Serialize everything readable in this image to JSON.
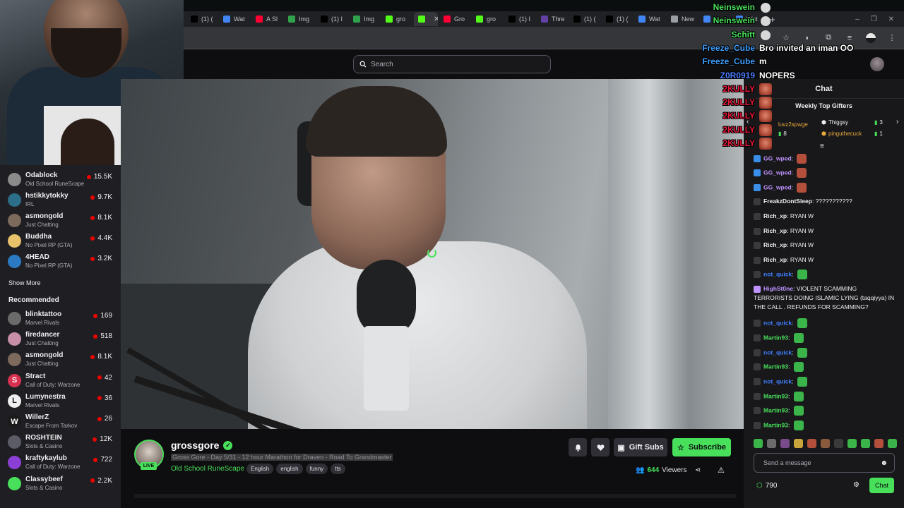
{
  "browser": {
    "tabs": [
      {
        "label": "(1) (",
        "icon": "x-logo",
        "color": "#000000"
      },
      {
        "label": "Wat",
        "icon": "globe-icon",
        "color": "#4285f4"
      },
      {
        "label": "A Sl",
        "icon": "youtube-icon",
        "color": "#ff0033"
      },
      {
        "label": "Img",
        "icon": "image-icon",
        "color": "#31a24c"
      },
      {
        "label": "(1) I",
        "icon": "x-logo",
        "color": "#000000"
      },
      {
        "label": "Img",
        "icon": "image-icon",
        "color": "#31a24c"
      },
      {
        "label": "gro",
        "icon": "kick-icon",
        "color": "#53fc18"
      },
      {
        "label": "",
        "icon": "kick-icon",
        "color": "#53fc18",
        "active": true
      },
      {
        "label": "Gro",
        "icon": "youtube-icon",
        "color": "#ff0033"
      },
      {
        "label": "gro",
        "icon": "kick-icon",
        "color": "#53fc18"
      },
      {
        "label": "(1) I",
        "icon": "x-logo",
        "color": "#000000"
      },
      {
        "label": "Thre",
        "icon": "threads-icon",
        "color": "#6441a5"
      },
      {
        "label": "(1) (",
        "icon": "x-logo",
        "color": "#000000"
      },
      {
        "label": "(1) (",
        "icon": "x-logo",
        "color": "#000000"
      },
      {
        "label": "Wat",
        "icon": "globe-icon",
        "color": "#4285f4"
      },
      {
        "label": "New",
        "icon": "chrome-icon",
        "color": "#9aa0a6"
      },
      {
        "label": "",
        "icon": "globe-icon",
        "color": "#4285f4"
      },
      {
        "label": "Wat",
        "icon": "globe-icon",
        "color": "#4285f4"
      }
    ],
    "newtab": "+",
    "window_controls": [
      "–",
      "❐",
      "✕"
    ]
  },
  "topnav": {
    "search_placeholder": "Search"
  },
  "sidebar": {
    "following": [
      {
        "name": "Odablock",
        "game": "Old School RuneScape",
        "viewers": "15.5K",
        "avatar": "#8a8a8a",
        "initial": ""
      },
      {
        "name": "hstikkytokky",
        "game": "IRL",
        "viewers": "9.7K",
        "avatar": "#2d6e8a",
        "initial": ""
      },
      {
        "name": "asmongold",
        "game": "Just Chatting",
        "viewers": "8.1K",
        "avatar": "#7d6a5c",
        "initial": ""
      },
      {
        "name": "Buddha",
        "game": "No Pixel RP (GTA)",
        "viewers": "4.4K",
        "avatar": "#e8c26a",
        "initial": ""
      },
      {
        "name": "4HEAD",
        "game": "No Pixel RP (GTA)",
        "viewers": "3.2K",
        "avatar": "#2a7bc4",
        "initial": ""
      }
    ],
    "show_more": "Show More",
    "recommended_title": "Recommended",
    "recommended": [
      {
        "name": "blinktattoo",
        "game": "Marvel Rivals",
        "viewers": "169",
        "avatar": "#6b6b6b",
        "initial": ""
      },
      {
        "name": "firedancer",
        "game": "Just Chatting",
        "viewers": "518",
        "avatar": "#c78fa8",
        "initial": ""
      },
      {
        "name": "asmongold",
        "game": "Just Chatting",
        "viewers": "8.1K",
        "avatar": "#7d6a5c",
        "initial": ""
      },
      {
        "name": "Stract",
        "game": "Call of Duty: Warzone",
        "viewers": "42",
        "avatar": "#d8314f",
        "initial": "S"
      },
      {
        "name": "Lumynestra",
        "game": "Marvel Rivals",
        "viewers": "36",
        "avatar": "#efeff1",
        "initial": "L"
      },
      {
        "name": "WillerZ",
        "game": "Escape From Tarkov",
        "viewers": "26",
        "avatar": "#1a1a1a",
        "initial": "W"
      },
      {
        "name": "ROSHTEIN",
        "game": "Slots & Casino",
        "viewers": "12K",
        "avatar": "#5c5c66",
        "initial": ""
      },
      {
        "name": "kraftykaylub",
        "game": "Call of Duty: Warzone",
        "viewers": "722",
        "avatar": "#8c3fd6",
        "initial": ""
      },
      {
        "name": "Classybeef",
        "game": "Slots & Casino",
        "viewers": "2.2K",
        "avatar": "#48e05a",
        "initial": ""
      }
    ]
  },
  "stream": {
    "streamer": "grossgore",
    "live_label": "LIVE",
    "title": "Gross Gore - Day 5/31 - 12 hour Marathon for Draven - Road To Grandmaster",
    "category": "Old School RuneScape",
    "tags": [
      "English",
      "english",
      "funny",
      "tts"
    ],
    "gift_label": "Gift Subs",
    "subscribe_label": "Subscribe",
    "viewer_count": "644",
    "viewers_label": "Viewers"
  },
  "chat": {
    "header": "Chat",
    "gifters_title": "Weekly Top Gifters",
    "gifters": [
      {
        "name": "luvz2spwge",
        "count": "8",
        "color": "#e8a93a"
      },
      {
        "name": "Thiggsy",
        "count": "3",
        "color": "#efeff1"
      },
      {
        "name": "pinguthecuck",
        "count": "1",
        "color": "#e8a93a"
      }
    ],
    "messages": [
      {
        "user": "GG_wped",
        "text": "",
        "color": "#bf94ff",
        "emote": "#b44f3c",
        "badge": "#3b8ee8"
      },
      {
        "user": "GG_wped",
        "text": "",
        "color": "#bf94ff",
        "emote": "#b44f3c",
        "badge": "#3b8ee8"
      },
      {
        "user": "GG_wped",
        "text": "",
        "color": "#bf94ff",
        "emote": "#b44f3c",
        "badge": "#3b8ee8"
      },
      {
        "user": "FreakzDontSleep",
        "text": "???????????",
        "color": "#efeff1",
        "emote": "",
        "badge": ""
      },
      {
        "user": "Rich_xp",
        "text": "RYAN W",
        "color": "#efeff1",
        "emote": "",
        "badge": ""
      },
      {
        "user": "Rich_xp",
        "text": "RYAN W",
        "color": "#efeff1",
        "emote": "",
        "badge": ""
      },
      {
        "user": "Rich_xp",
        "text": "RYAN W",
        "color": "#efeff1",
        "emote": "",
        "badge": ""
      },
      {
        "user": "Rich_xp",
        "text": "RYAN W",
        "color": "#efeff1",
        "emote": "",
        "badge": ""
      },
      {
        "user": "not_quick",
        "text": "",
        "color": "#3f7fff",
        "emote": "#3bb54a",
        "badge": ""
      },
      {
        "user": "HighSt0ne",
        "text": "VIOLENT SCAMMING TERRORISTS DOING ISLAMIC LYING (taqqiyya) IN THE CALL . REFUNDS FOR SCAMMING?",
        "color": "#bf94ff",
        "emote": "",
        "badge": "#bf94ff"
      },
      {
        "user": "not_quick",
        "text": "",
        "color": "#3f7fff",
        "emote": "#3bb54a",
        "badge": ""
      },
      {
        "user": "Martin93",
        "text": "",
        "color": "#48e05a",
        "emote": "#3bb54a",
        "badge": ""
      },
      {
        "user": "not_quick",
        "text": "",
        "color": "#3f7fff",
        "emote": "#3bb54a",
        "badge": ""
      },
      {
        "user": "Martin93",
        "text": "",
        "color": "#48e05a",
        "emote": "#3bb54a",
        "badge": ""
      },
      {
        "user": "not_quick",
        "text": "",
        "color": "#3f7fff",
        "emote": "#3bb54a",
        "badge": ""
      },
      {
        "user": "Martin93",
        "text": "",
        "color": "#48e05a",
        "emote": "#3bb54a",
        "badge": ""
      },
      {
        "user": "Martin93",
        "text": "",
        "color": "#48e05a",
        "emote": "#3bb54a",
        "badge": ""
      },
      {
        "user": "Martin93",
        "text": "",
        "color": "#48e05a",
        "emote": "#3bb54a",
        "badge": ""
      }
    ],
    "emote_bar": [
      "#3bb54a",
      "#6b6b6b",
      "#7a4b8c",
      "#c8a43a",
      "#b44f3c",
      "#8a5a3c",
      "#3a3a3a",
      "#3bb54a",
      "#3bb54a",
      "#b44f3c",
      "#3bb54a"
    ],
    "input_placeholder": "Send a message",
    "points": "790",
    "chat_button": "Chat"
  },
  "overlay_chat": [
    {
      "user": "Neinswein",
      "text": "",
      "color": "#48e05a",
      "emote": "skull"
    },
    {
      "user": "Neinswein",
      "text": "",
      "color": "#48e05a",
      "emote": "skull"
    },
    {
      "user": "Schitt",
      "text": "",
      "color": "#48e05a",
      "emote": "skull"
    },
    {
      "user": "Freeze_Cube",
      "text": "Bro invited an iman OO",
      "color": "#3f9fff",
      "emote": ""
    },
    {
      "user": "Freeze_Cube",
      "text": "m",
      "color": "#3f9fff",
      "emote": ""
    },
    {
      "user": "Z0R0919",
      "text": "NOPERS",
      "color": "#4b7bff",
      "emote": ""
    },
    {
      "user": "2KULLY",
      "text": "",
      "color": "#e8173a",
      "emote": "face"
    },
    {
      "user": "2KULLY",
      "text": "",
      "color": "#e8173a",
      "emote": "face"
    },
    {
      "user": "2KULLY",
      "text": "",
      "color": "#e8173a",
      "emote": "face"
    },
    {
      "user": "2KULLY",
      "text": "",
      "color": "#e8173a",
      "emote": "face"
    },
    {
      "user": "2KULLY",
      "text": "",
      "color": "#e8173a",
      "emote": "face"
    }
  ]
}
